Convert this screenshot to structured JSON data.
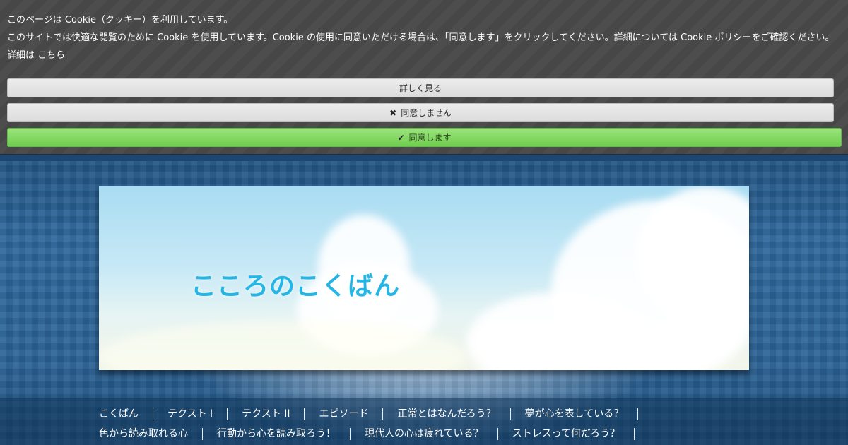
{
  "cookie_banner": {
    "title": "このページは Cookie（クッキー）を利用しています。",
    "message": "このサイトでは快適な閲覧のために Cookie を使用しています。Cookie の使用に同意いただける場合は、「同意します」をクリックしてください。詳細については Cookie ポリシーをご確認ください。",
    "details_prefix": "詳細は",
    "details_link": "こちら",
    "buttons": {
      "more": "詳しく見る",
      "decline": "同意しません",
      "accept": "同意します"
    },
    "icons": {
      "decline": "close-icon",
      "accept": "checkmark-icon"
    }
  },
  "site": {
    "title": "こころのこくばん"
  },
  "nav": {
    "row1": [
      "こくばん",
      "テクスト I",
      "テクスト II",
      "エピソード",
      "正常とはなんだろう？",
      "夢が心を表している？"
    ],
    "row2": [
      "色から読み取れる心",
      "行動から心を読み取ろう！",
      "現代人の心は疲れている？",
      "ストレスって何だろう？"
    ]
  },
  "colors": {
    "banner_bg": "#474747",
    "accept_button": "#7fd65c",
    "title_color": "#25b6e6",
    "site_bg": "#2c5f8f"
  }
}
